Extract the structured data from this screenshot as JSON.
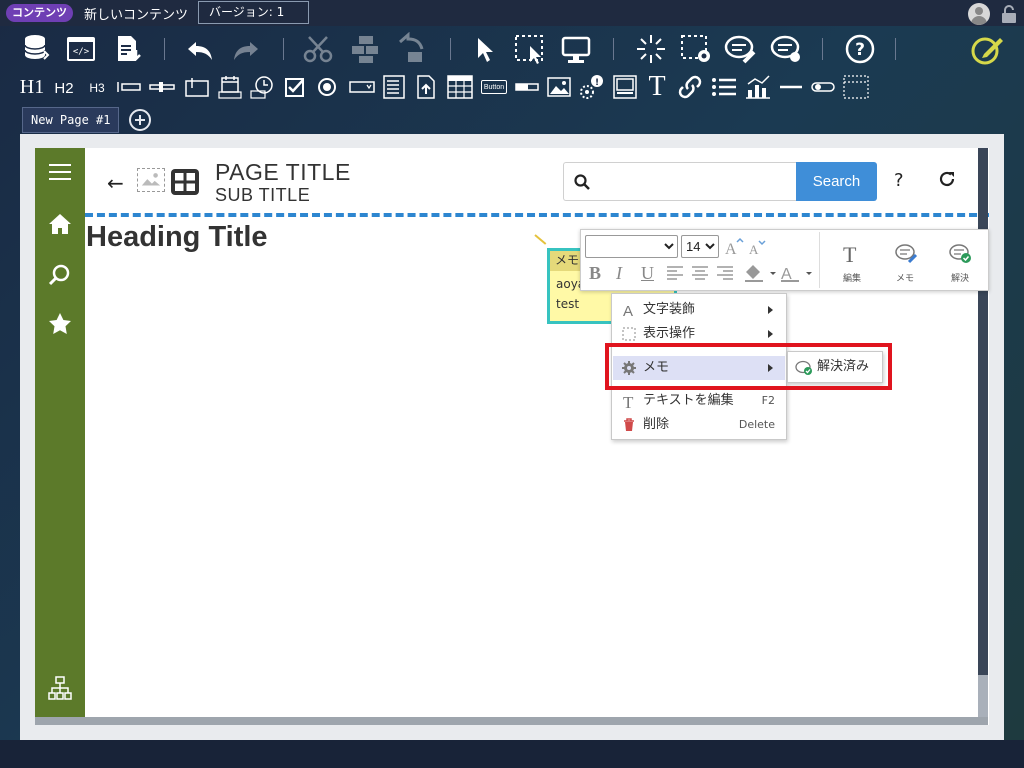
{
  "titlebar": {
    "badge": "コンテンツ",
    "doc_name": "新しいコンテンツ",
    "version": "バージョン: 1"
  },
  "toolbar2": {
    "h1": "H1",
    "h2": "H2",
    "h3": "H3",
    "button_label": "Button",
    "text_T": "T"
  },
  "tabs": {
    "active": "New Page #1"
  },
  "page": {
    "title": "PAGE TITLE",
    "subtitle": "SUB TITLE",
    "search_button": "Search",
    "help": "?",
    "heading": "Heading Title"
  },
  "memo": {
    "header": "メモ",
    "line1": "aoyag",
    "line2": "test"
  },
  "format_toolbar": {
    "font_family": "",
    "font_size": "14",
    "edit_label": "編集",
    "memo_label": "メモ",
    "resolve_label": "解決"
  },
  "context_menu": {
    "items": [
      {
        "label": "文字装飾"
      },
      {
        "label": "表示操作"
      },
      {
        "label": "メモ"
      },
      {
        "label": "テキストを編集",
        "shortcut": "F2"
      },
      {
        "label": "削除",
        "shortcut": "Delete"
      }
    ],
    "submenu": {
      "label": "解決済み"
    }
  }
}
